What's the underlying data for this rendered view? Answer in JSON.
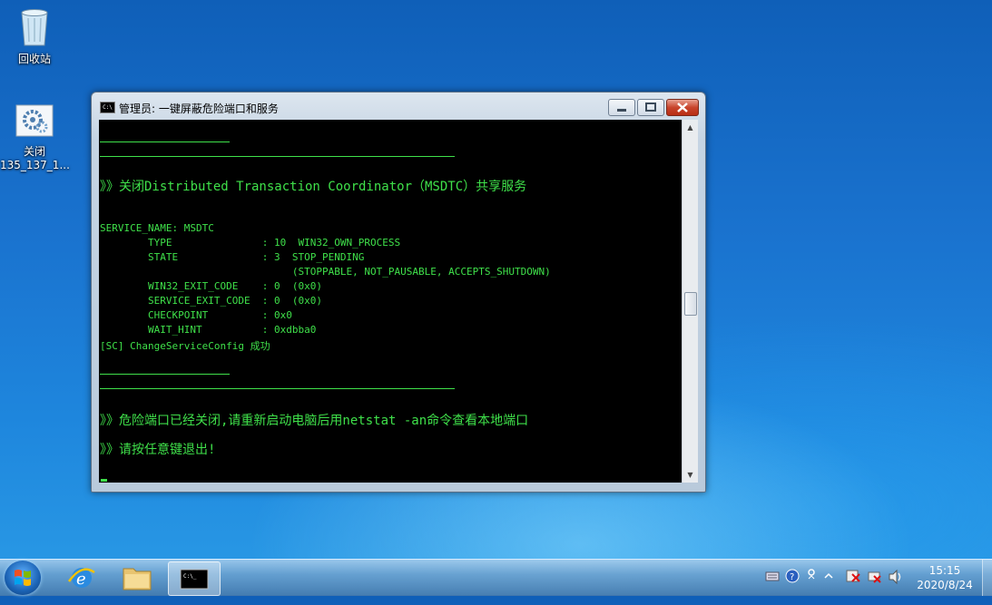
{
  "desktop": {
    "recycle_bin_label": "回收站",
    "shortcut_label_line1": "关闭",
    "shortcut_label_line2": "135_137_1..."
  },
  "window": {
    "title": "管理员:  一键屏蔽危险端口和服务",
    "icon_text": "C:\\",
    "lines": {
      "l1": "关闭Distributed Transaction Coordinator（MSDTC）共享服务",
      "l2": "SERVICE_NAME: MSDTC",
      "l3": "        TYPE               : 10  WIN32_OWN_PROCESS",
      "l4": "        STATE              : 3  STOP_PENDING",
      "l5": "                                (STOPPABLE, NOT_PAUSABLE, ACCEPTS_SHUTDOWN)",
      "l6": "        WIN32_EXIT_CODE    : 0  (0x0)",
      "l7": "        SERVICE_EXIT_CODE  : 0  (0x0)",
      "l8": "        CHECKPOINT         : 0x0",
      "l9": "        WAIT_HINT          : 0xdbba0",
      "l10": "[SC] ChangeServiceConfig 成功",
      "l11": "危险端口已经关闭,请重新启动电脑后用netstat -an命令查看本地端口",
      "l12": "请按任意键退出!"
    },
    "prompt_marker": "》》"
  },
  "taskbar": {
    "apps": [
      "start",
      "internet-explorer",
      "file-explorer",
      "command-prompt"
    ],
    "clock_time": "15:15",
    "clock_date": "2020/8/24"
  }
}
